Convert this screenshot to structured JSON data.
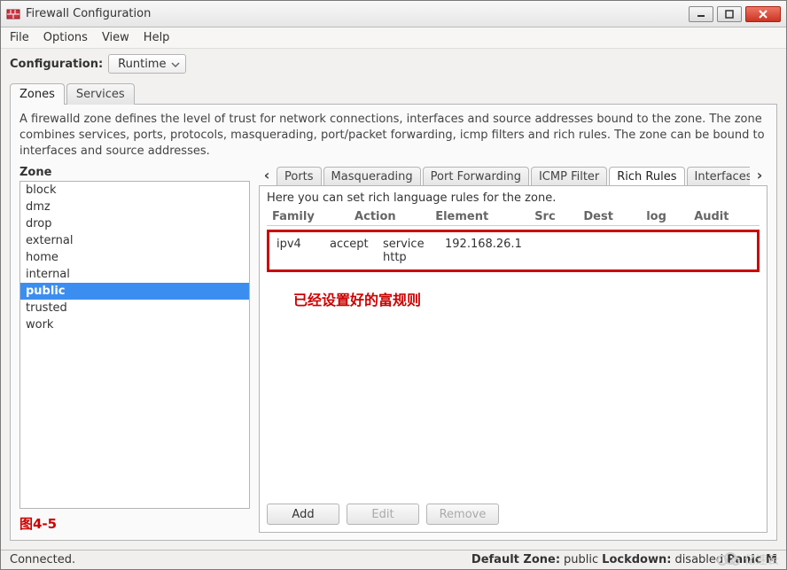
{
  "window": {
    "title": "Firewall Configuration"
  },
  "menu": {
    "file": "File",
    "options": "Options",
    "view": "View",
    "help": "Help"
  },
  "config": {
    "label": "Configuration:",
    "value": "Runtime"
  },
  "main_tabs": {
    "zones": "Zones",
    "services": "Services"
  },
  "zone_description": "A firewalld zone defines the level of trust for network connections, interfaces and source addresses bound to the zone. The zone combines services, ports, protocols, masquerading, port/packet forwarding, icmp filters and rich rules. The zone can be bound to interfaces and source addresses.",
  "zone_label": "Zone",
  "zones": [
    "block",
    "dmz",
    "drop",
    "external",
    "home",
    "internal",
    "public",
    "trusted",
    "work"
  ],
  "zone_selected": "public",
  "figure_label": "图4-5",
  "right_tabs": {
    "ports": "Ports",
    "masq": "Masquerading",
    "pf": "Port Forwarding",
    "icmp": "ICMP Filter",
    "rich": "Rich Rules",
    "if": "Interfaces"
  },
  "rich_help": "Here you can set rich language rules for the zone.",
  "rule_headers": {
    "family": "Family",
    "action": "Action",
    "element": "Element",
    "src": "Src",
    "dest": "Dest",
    "log": "log",
    "audit": "Audit"
  },
  "rules": [
    {
      "family": "ipv4",
      "action": "accept",
      "element": "service http",
      "src": "192.168.26.1",
      "dest": "",
      "log": "",
      "audit": ""
    }
  ],
  "annotation": "已经设置好的富规则",
  "buttons": {
    "add": "Add",
    "edit": "Edit",
    "remove": "Remove"
  },
  "status": {
    "connected": "Connected.",
    "default_zone_label": "Default Zone:",
    "default_zone": "public",
    "lockdown_label": "Lockdown:",
    "lockdown": "disabled",
    "panic_label": "Panic M"
  },
  "watermark": "亿速云"
}
